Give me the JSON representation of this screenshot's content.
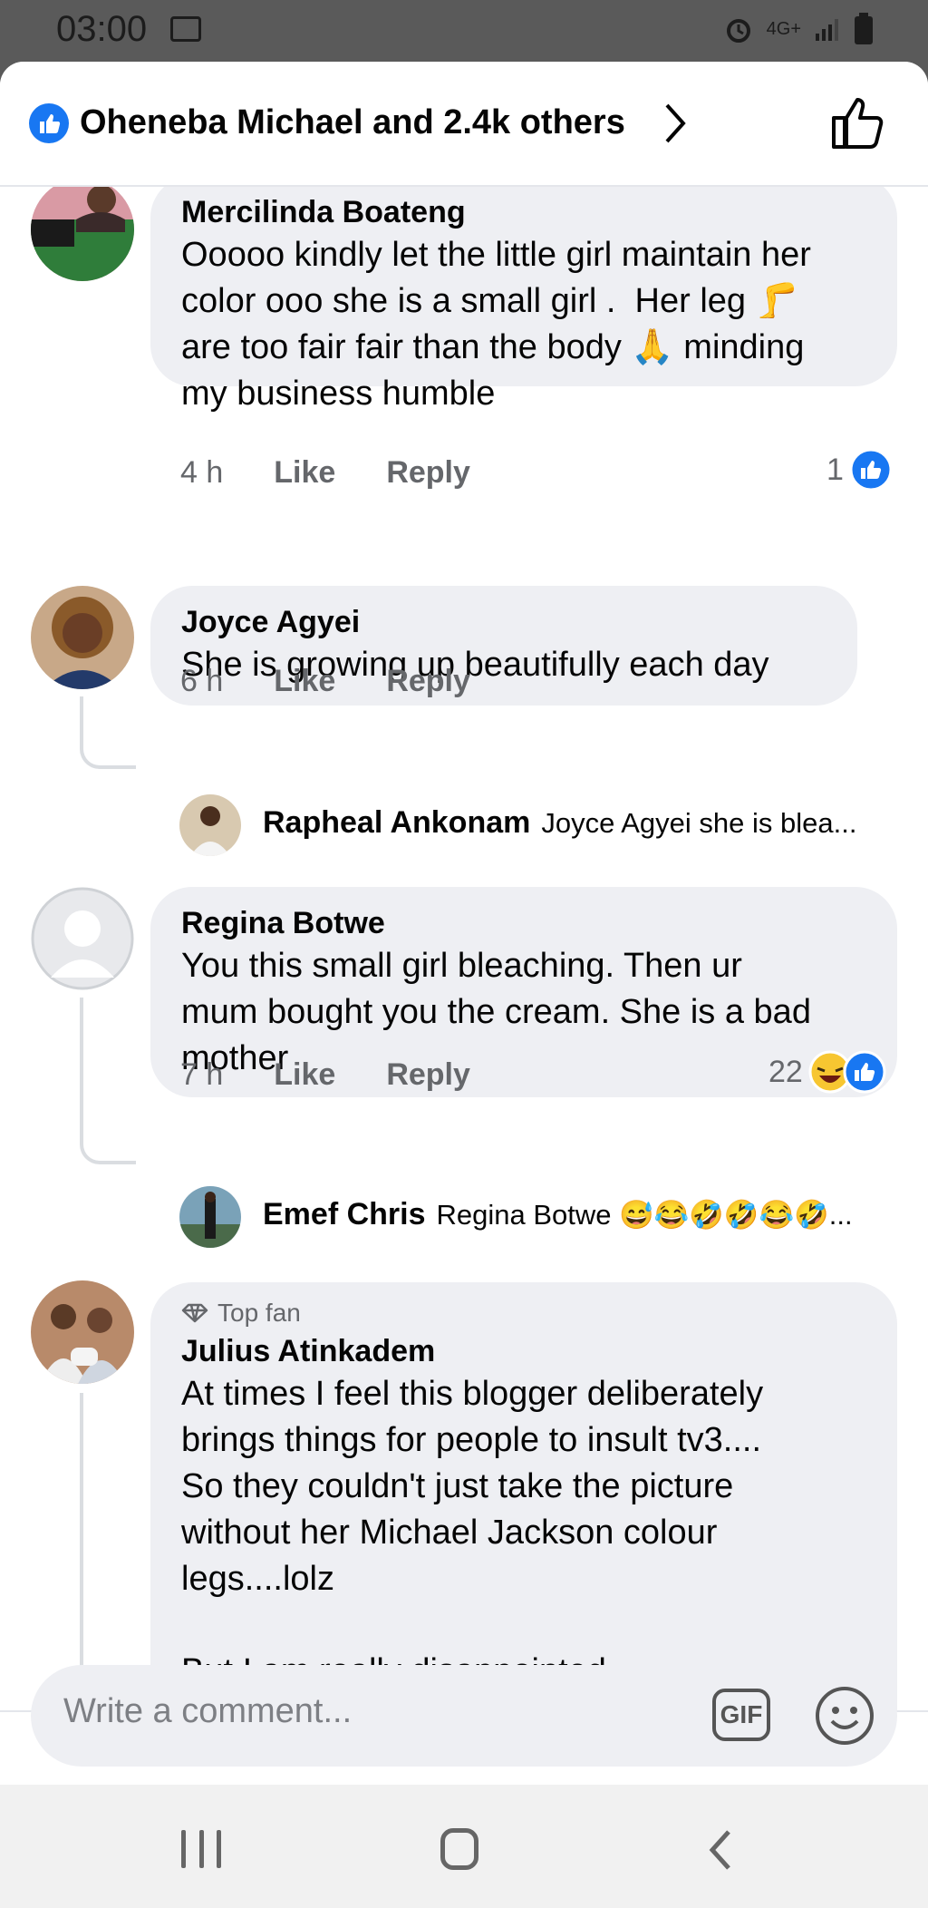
{
  "status_bar": {
    "time": "03:00",
    "network": "4G+"
  },
  "header": {
    "reactors_text": "Oheneba Michael and 2.4k others"
  },
  "comments": [
    {
      "name": "Mercilinda Boateng",
      "text": "Ooooo kindly let the little girl maintain her\ncolor ooo she is a small girl .  Her leg 🦵\nare too fair fair than the body 🙏 minding\nmy business humble",
      "time": "4 h",
      "like_label": "Like",
      "reply_label": "Reply",
      "reactions": "1"
    },
    {
      "name": "Joyce Agyei",
      "text": "She is growing up beautifully each day",
      "time": "6 h",
      "like_label": "Like",
      "reply_label": "Reply",
      "reply": {
        "name": "Rapheal Ankonam",
        "preview": "Joyce Agyei she is blea..."
      }
    },
    {
      "name": "Regina Botwe",
      "text": "You this small girl bleaching. Then ur\nmum bought you the cream. She is a bad\nmother",
      "time": "7 h",
      "like_label": "Like",
      "reply_label": "Reply",
      "reactions": "22",
      "reply": {
        "name": "Emef Chris",
        "preview": "Regina Botwe 😅😂🤣🤣😂🤣..."
      }
    },
    {
      "badge": "Top fan",
      "name": "Julius Atinkadem",
      "text": "At times I feel this blogger deliberately\nbrings things for people to insult tv3....\nSo they couldn't just take the picture\nwithout her Michael Jackson colour\nlegs....lolz\n\nBut I am really disappointed"
    }
  ],
  "composer": {
    "placeholder": "Write a comment...",
    "gif_label": "GIF"
  },
  "colors": {
    "accent": "#1877f2",
    "bubble": "#eeeff3",
    "meta_text": "#65676b"
  },
  "icons": [
    "image-icon",
    "alarm-icon",
    "signal-icon",
    "battery-icon",
    "like-icon",
    "chevron-right-icon",
    "thumbs-up-icon",
    "diamond-icon",
    "laugh-icon",
    "emoji-icon",
    "recent-apps-icon",
    "home-icon",
    "back-icon"
  ]
}
